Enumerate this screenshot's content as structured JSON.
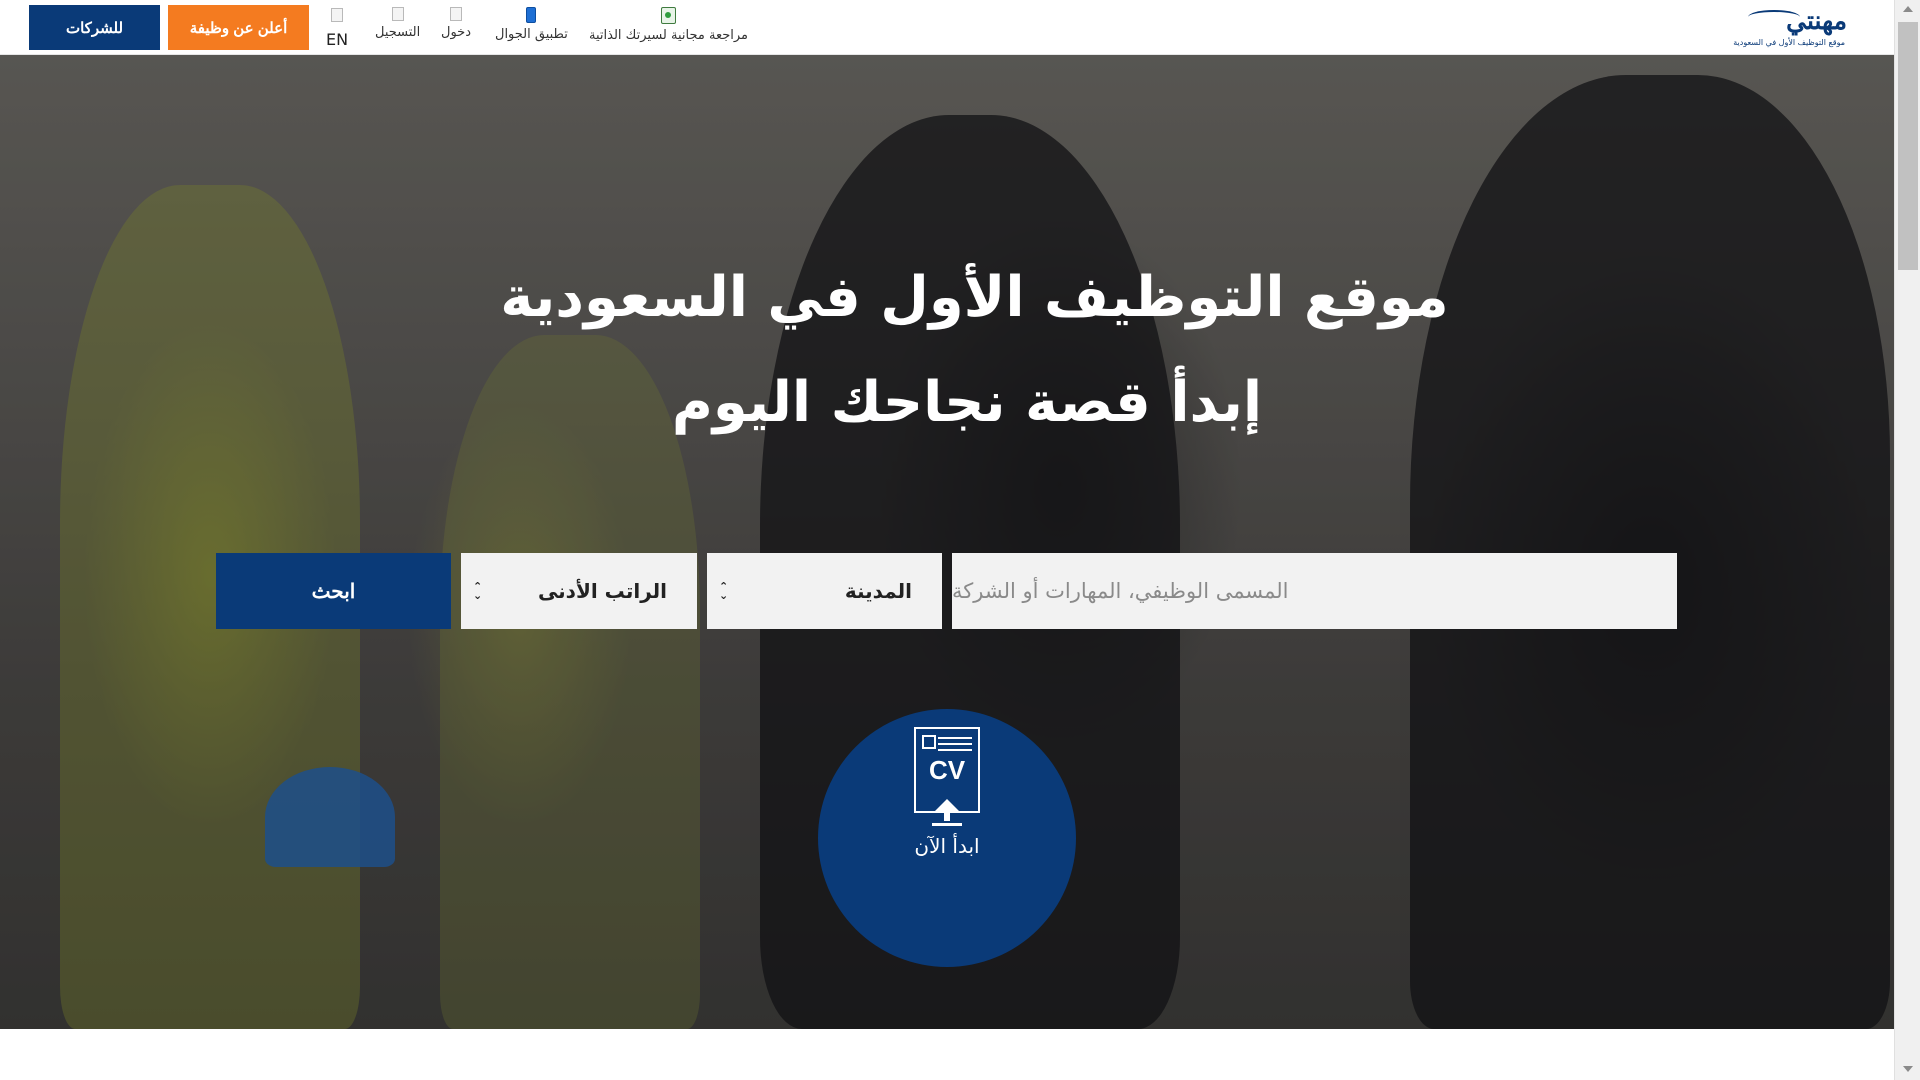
{
  "header": {
    "companies_label": "للشركات",
    "post_job_label": "أعلن عن وظيفة",
    "lang_label": "EN",
    "register_label": "التسجيل",
    "login_label": "دخول",
    "mobile_app_label": "تطبيق الجوال",
    "cv_review_label": "مراجعة مجانية لسيرتك الذاتية",
    "logo_word": "مهنتي",
    "logo_tagline": "موقع التوظيف الأول في السعودية"
  },
  "hero": {
    "title_line1": "موقع التوظيف الأول في السعودية",
    "title_line2": "إبدأ قصة نجاحك اليوم"
  },
  "search": {
    "keyword_placeholder": "المسمى الوظيفي، المهارات أو الشركة",
    "city_label": "المدينة",
    "salary_label": "الراتب الأدنى",
    "search_button": "ابحث"
  },
  "cv_cta": {
    "icon_text": "CV",
    "label": "ابدأ الآن"
  },
  "colors": {
    "brand_blue": "#0a3a78",
    "accent_orange": "#f47b20"
  },
  "icons": [
    "lang-icon",
    "register-icon",
    "login-icon",
    "mobile-phone-icon",
    "cv-review-icon",
    "cv-upload-icon"
  ]
}
